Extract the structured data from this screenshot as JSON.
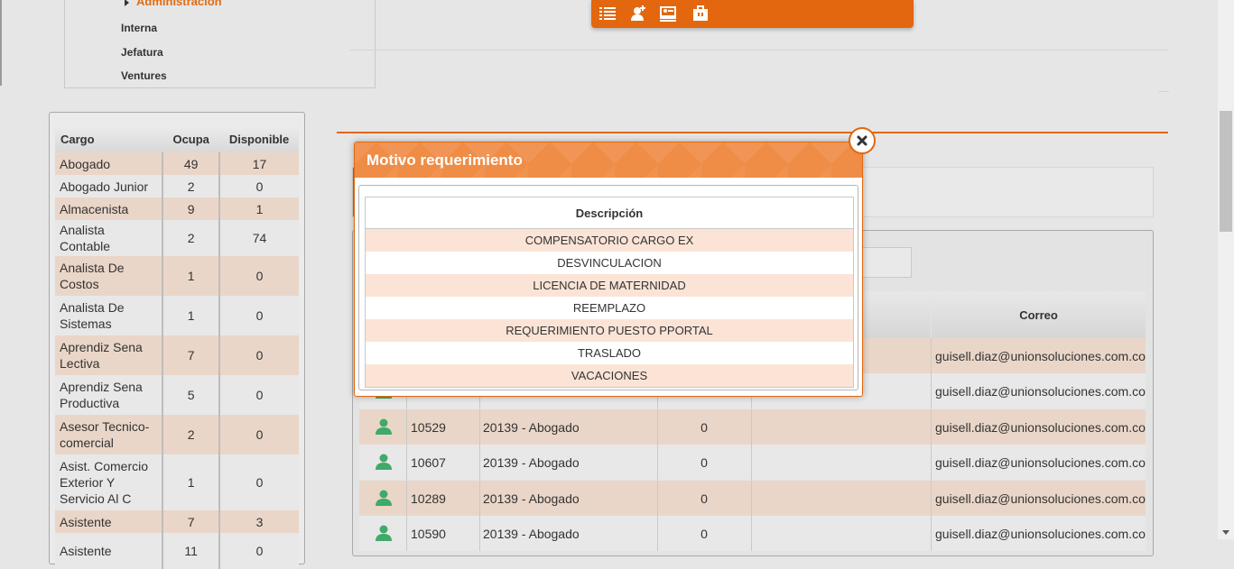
{
  "tree": {
    "selected": "Administracion",
    "items": [
      "Interna",
      "Jefatura",
      "Ventures"
    ]
  },
  "toolbar": {
    "icons": [
      "list-icon",
      "user-add-icon",
      "id-card-icon",
      "briefcase-icon"
    ]
  },
  "cargo_table": {
    "headers": [
      "Cargo",
      "Ocupa",
      "Disponible"
    ],
    "rows": [
      {
        "cargo": "Abogado",
        "ocupa": "49",
        "disponible": "17"
      },
      {
        "cargo": "Abogado Junior",
        "ocupa": "2",
        "disponible": "0"
      },
      {
        "cargo": "Almacenista",
        "ocupa": "9",
        "disponible": "1"
      },
      {
        "cargo": "Analista Contable",
        "ocupa": "2",
        "disponible": "74"
      },
      {
        "cargo": "Analista De Costos",
        "ocupa": "1",
        "disponible": "0"
      },
      {
        "cargo": "Analista De Sistemas",
        "ocupa": "1",
        "disponible": "0"
      },
      {
        "cargo": "Aprendiz Sena Lectiva",
        "ocupa": "7",
        "disponible": "0"
      },
      {
        "cargo": "Aprendiz Sena Productiva",
        "ocupa": "5",
        "disponible": "0"
      },
      {
        "cargo": "Asesor Tecnico-comercial",
        "ocupa": "2",
        "disponible": "0"
      },
      {
        "cargo": "Asist. Comercio Exterior Y Servicio Al C",
        "ocupa": "1",
        "disponible": "0"
      },
      {
        "cargo": "Asistente",
        "ocupa": "7",
        "disponible": "3"
      },
      {
        "cargo": "Asistente",
        "ocupa": "11",
        "disponible": "0"
      }
    ]
  },
  "main_table": {
    "correo_header": "Correo",
    "rows": [
      {
        "id": "",
        "cargo": "",
        "valor": "",
        "correo": "guisell.diaz@unionsoluciones.com.co"
      },
      {
        "id": "",
        "cargo": "",
        "valor": "",
        "correo": "guisell.diaz@unionsoluciones.com.co"
      },
      {
        "id": "10529",
        "cargo": "20139 - Abogado",
        "valor": "0",
        "correo": "guisell.diaz@unionsoluciones.com.co"
      },
      {
        "id": "10607",
        "cargo": "20139 - Abogado",
        "valor": "0",
        "correo": "guisell.diaz@unionsoluciones.com.co"
      },
      {
        "id": "10289",
        "cargo": "20139 - Abogado",
        "valor": "0",
        "correo": "guisell.diaz@unionsoluciones.com.co"
      },
      {
        "id": "10590",
        "cargo": "20139 - Abogado",
        "valor": "0",
        "correo": "guisell.diaz@unionsoluciones.com.co"
      }
    ]
  },
  "modal": {
    "title": "Motivo requerimiento",
    "column": "Descripción",
    "items": [
      "COMPENSATORIO CARGO EX",
      "DESVINCULACION",
      "LICENCIA DE MATERNIDAD",
      "REEMPLAZO",
      "REQUERIMIENTO PUESTO PPORTAL",
      "TRASLADO",
      "VACACIONES"
    ]
  },
  "colors": {
    "accent": "#e2670e",
    "row_highlight": "#ead6c8",
    "modal_row": "#fbe4d6"
  }
}
